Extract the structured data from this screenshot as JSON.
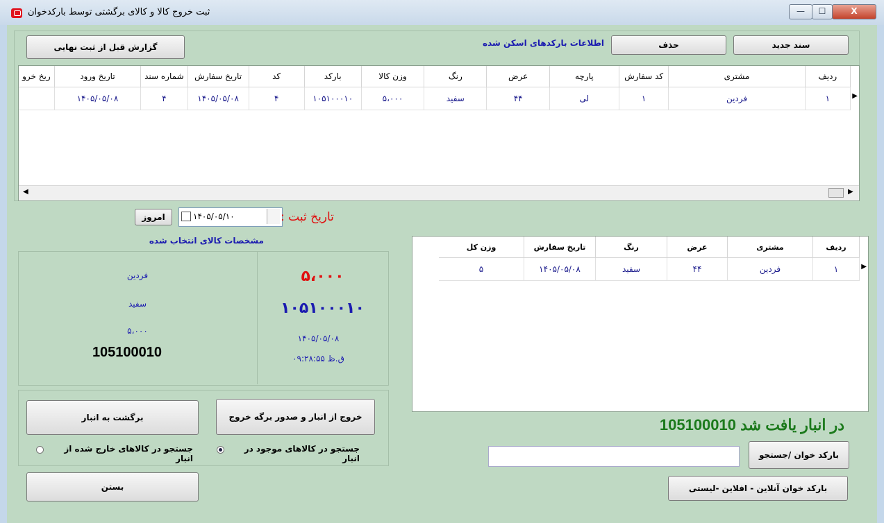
{
  "window": {
    "title": "ثبت خروج کالا و کالای برگشتی توسط بارکدخوان",
    "minimize": "—",
    "maximize": "☐",
    "close": "X"
  },
  "toolbar": {
    "report_button": "گزارش قبل از ثبت نهایی",
    "scanned_label": "اطلاعات بارکدهای اسکن شده",
    "delete_button": "حذف",
    "new_doc_button": "سند جدید"
  },
  "top_grid": {
    "columns": [
      "ردیف",
      "مشتری",
      "کد سفارش",
      "پارچه",
      "عرض",
      "رنگ",
      "وزن کالا",
      "بارکد",
      "کد",
      "تاریخ سفارش",
      "شماره سند",
      "تاریخ ورود",
      "ریخ خرو"
    ],
    "rows": [
      [
        "۱",
        "فردین",
        "۱",
        "لی",
        "۴۴",
        "سفید",
        "۵،۰۰۰",
        "۱۰۵۱۰۰۰۱۰",
        "۴",
        "۱۴۰۵/۰۵/۰۸",
        "۴",
        "۱۴۰۵/۰۵/۰۸",
        ""
      ]
    ],
    "row_marker": "▶"
  },
  "date_section": {
    "today_button": "امروز",
    "date_value": "۱۴۰۵/۰۵/۱۰",
    "label": "تاریخ ثبت :"
  },
  "selected": {
    "title": "مشخصات کالای انتخاب شده",
    "left": {
      "customer": "فردین",
      "color": "سفید",
      "weight": "۵،۰۰۰",
      "barcode": "105100010"
    },
    "right": {
      "weight": "۵،۰۰۰",
      "barcode": "۱۰۵۱۰۰۰۱۰",
      "date": "۱۴۰۵/۰۵/۰۸",
      "time": "ق.ظ ۰۹:۲۸:۵۵"
    }
  },
  "bottom_grid": {
    "columns": [
      "ردیف",
      "مشتری",
      "عرض",
      "رنگ",
      "تاریخ سفارش",
      "وزن کل"
    ],
    "rows": [
      [
        "۱",
        "فردین",
        "۴۴",
        "سفید",
        "۱۴۰۵/۰۵/۰۸",
        "۵"
      ]
    ],
    "row_marker": "▶"
  },
  "actions": {
    "return_button": "برگشت به انبار",
    "exit_button": "خروج از انبار و صدور برگه خروج",
    "radio_exited": "جستجو در کالاهای خارج شده از انبار",
    "radio_stock": "جستجو در کالاهای موجود در انبار",
    "close_button": "بستن"
  },
  "barcode": {
    "found_message": "در انبار یافت شد 105100010",
    "search_button": "بارکد خوان /جستجو",
    "search_value": "",
    "mode_button": "بارکد خوان آنلاین - افلاین -لیستی"
  },
  "colors": {
    "background": "#bfd9c3",
    "accent_blue": "#1b1bb0",
    "red": "#e01010",
    "found_green": "#1c7a1c"
  }
}
